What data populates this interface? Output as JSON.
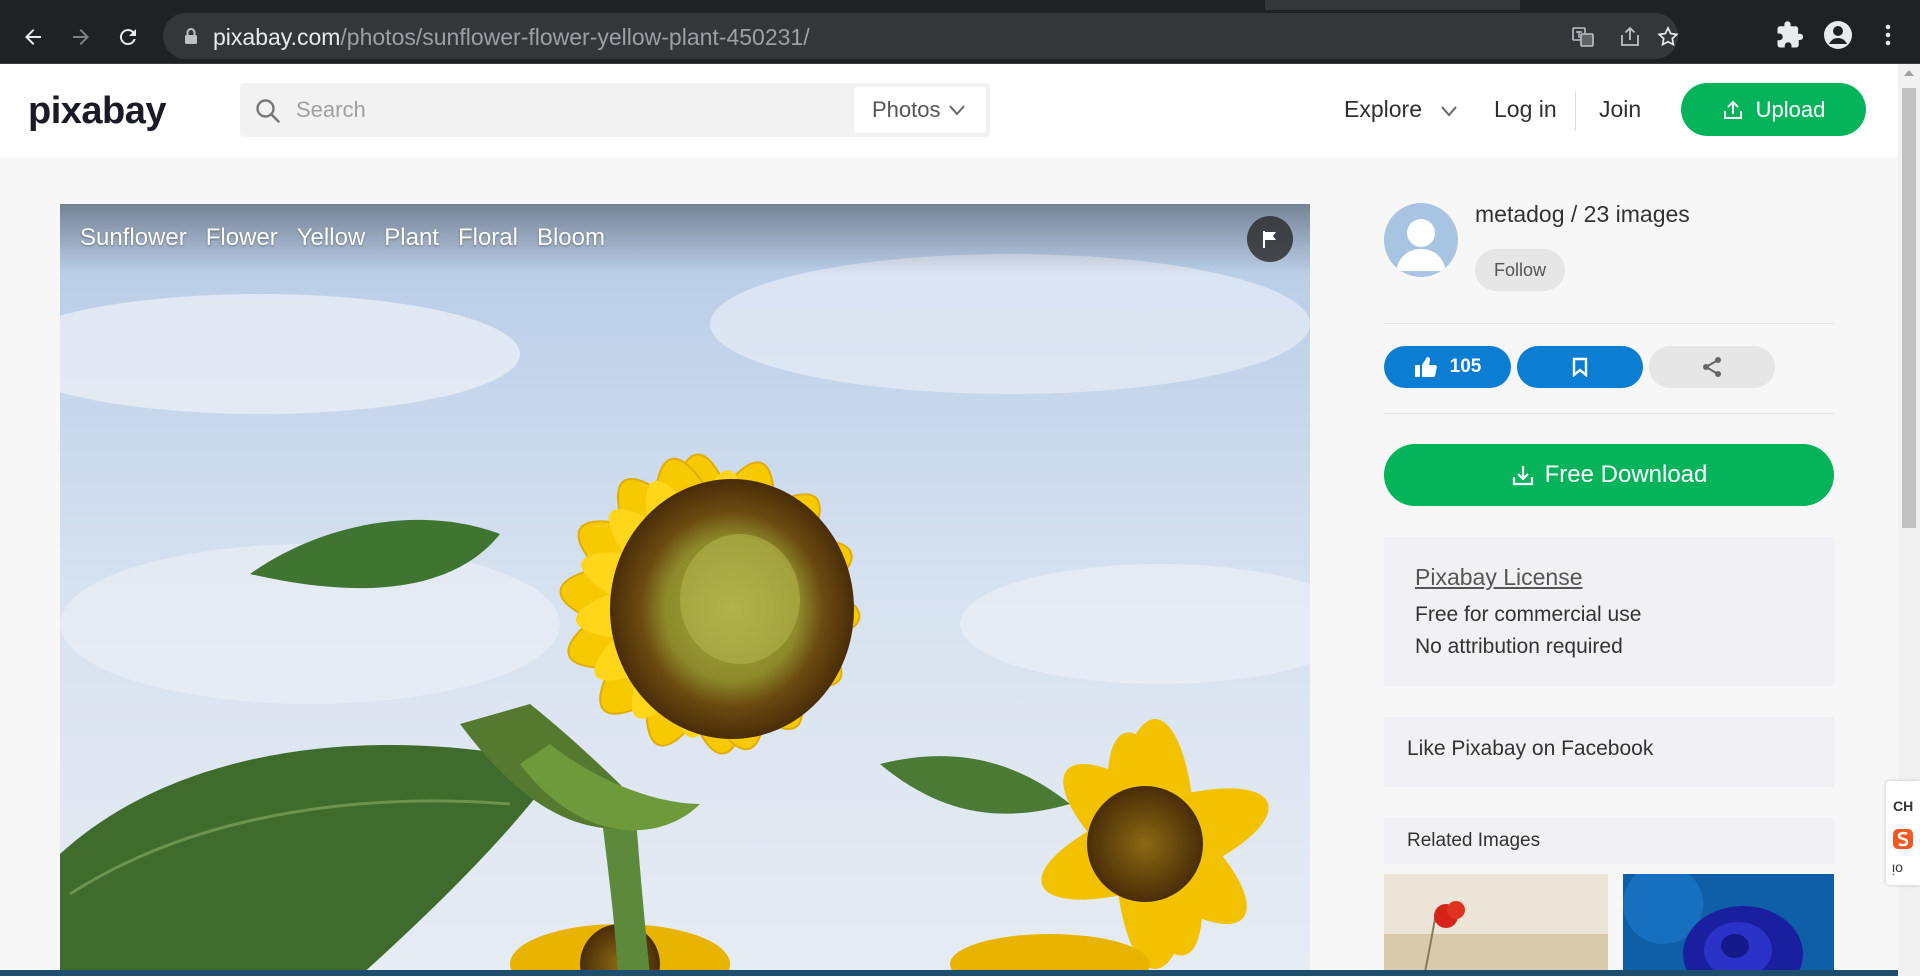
{
  "browser": {
    "url_host": "pixabay.com",
    "url_path": "/photos/sunflower-flower-yellow-plant-450231/"
  },
  "header": {
    "logo": "pixabay",
    "search_placeholder": "Search",
    "search_type": "Photos",
    "explore": "Explore",
    "login": "Log in",
    "join": "Join",
    "upload": "Upload"
  },
  "photo": {
    "tags": [
      "Sunflower",
      "Flower",
      "Yellow",
      "Plant",
      "Floral",
      "Bloom"
    ]
  },
  "sidebar": {
    "author": "metadog / 23 images",
    "follow": "Follow",
    "likes": "105",
    "download": "Free Download",
    "license": {
      "title": "Pixabay License",
      "line1": "Free for commercial use",
      "line2": "No attribution required"
    },
    "facebook": "Like Pixabay on Facebook",
    "related": "Related Images"
  },
  "ime": {
    "lang": "CH",
    "mode": "ᴉo"
  },
  "colors": {
    "accent_green": "#05b45a",
    "accent_blue": "#0b7ed4"
  },
  "icons": [
    "back-icon",
    "forward-icon",
    "reload-icon",
    "lock-icon",
    "translate-icon",
    "share-page-icon",
    "bookmark-star-icon",
    "extensions-icon",
    "profile-icon",
    "menu-icon",
    "search-icon",
    "chevron-down-icon",
    "upload-icon",
    "flag-icon",
    "thumbs-up-icon",
    "bookmark-icon",
    "share-icon",
    "download-icon"
  ]
}
